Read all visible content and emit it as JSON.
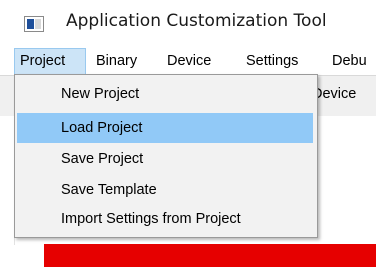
{
  "window": {
    "title": "Application Customization Tool"
  },
  "menubar": {
    "items": [
      {
        "label": "Project"
      },
      {
        "label": "Binary"
      },
      {
        "label": "Device"
      },
      {
        "label": "Settings"
      },
      {
        "label": "Debu"
      }
    ]
  },
  "tabs": {
    "visible_tab": "Device"
  },
  "project_menu": {
    "items": [
      {
        "label": "New Project"
      },
      {
        "label": "Load Project",
        "highlighted": true
      },
      {
        "label": "Save Project"
      },
      {
        "label": "Save Template"
      },
      {
        "label": "Import Settings from Project"
      }
    ]
  },
  "colors": {
    "menu_highlight": "#91c9f7",
    "active_menu": "#cce4f7",
    "red_bar": "#e60000",
    "app_icon_blue": "#1e4f9a"
  },
  "icons": {
    "app": "app-window-icon"
  }
}
